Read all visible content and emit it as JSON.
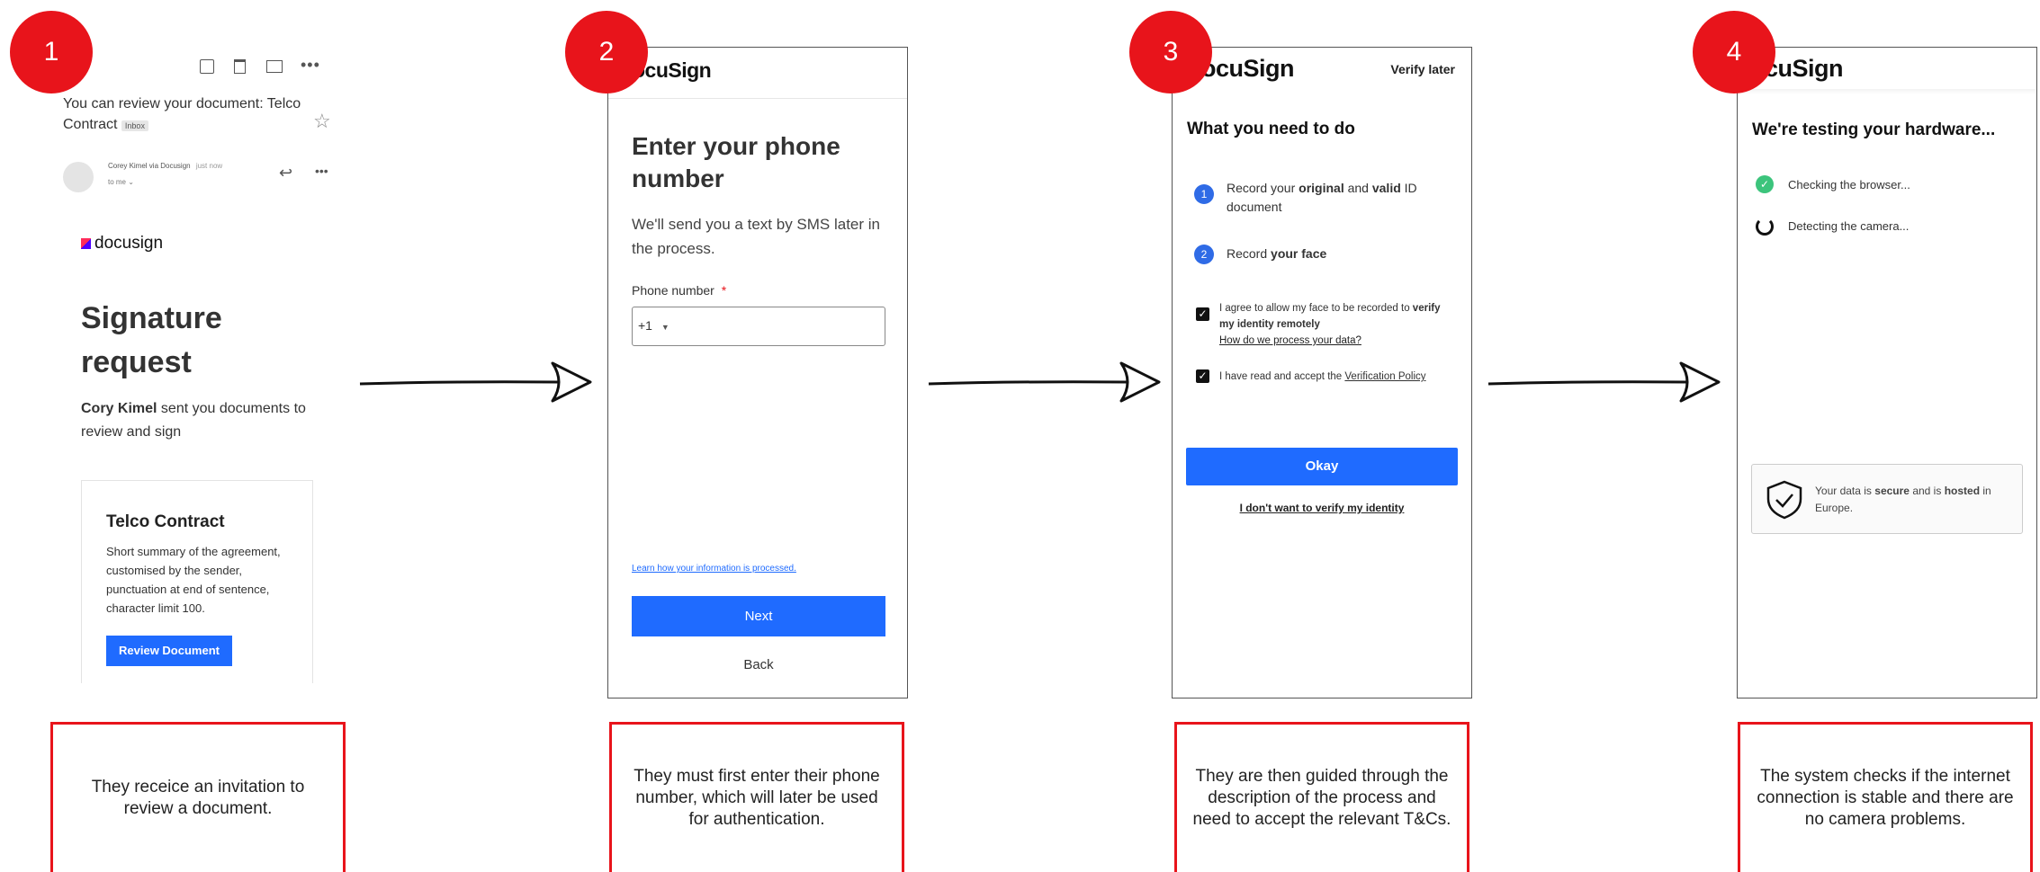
{
  "steps": [
    {
      "number": "1",
      "caption": "They receice an invitation to review a document.",
      "email": {
        "subject": "You can review your document: Telco Contract",
        "inbox_tag": "Inbox",
        "sender": "Corey Kimel via Docusign",
        "sent_time": "just now",
        "to_me": "to me",
        "brand": "docusign",
        "heading": "Signature request",
        "sender_name": "Cory Kimel",
        "message": "sent you documents to review and sign",
        "card_title": "Telco Contract",
        "card_summary": "Short summary of the agreement, customised by the sender, punctuation at end of sentence, character limit 100.",
        "review_button": "Review Document"
      }
    },
    {
      "number": "2",
      "caption": "They must first enter their phone number, which will later be used for authentication.",
      "screen": {
        "logo": "ocuSign",
        "title": "Enter your phone number",
        "subtitle": "We'll send you a text by SMS later in the process.",
        "field_label": "Phone number",
        "required_mark": "*",
        "country_code": "+1",
        "learn_link": "Learn how your information is processed.",
        "next_button": "Next",
        "back_button": "Back"
      }
    },
    {
      "number": "3",
      "caption": "They are then guided through the description of the process and need to accept the relevant T&Cs.",
      "screen": {
        "logo": "ocuSign",
        "verify_later": "Verify later",
        "title": "What you need to do",
        "step1_num": "1",
        "step1_a": "Record your ",
        "step1_b": "original",
        "step1_c": " and ",
        "step1_d": "valid",
        "step1_e": " ID document",
        "step2_num": "2",
        "step2_a": "Record ",
        "step2_b": "your face",
        "consent1_a": "I agree to allow my face to be recorded to ",
        "consent1_b": "verify my identity remotely",
        "consent1_link": "How do we process your data?",
        "consent2_a": "I have read and accept the ",
        "consent2_link": "Verification Policy",
        "okay_button": "Okay",
        "decline_link": "I don't want to verify my identity"
      }
    },
    {
      "number": "4",
      "caption": "The system checks if the internet connection is stable and there are no camera problems.",
      "screen": {
        "logo": "ocuSign",
        "title": "We're testing your hardware...",
        "check1": "Checking the browser...",
        "check2": "Detecting the camera...",
        "notice_a": "Your data is ",
        "notice_b": "secure",
        "notice_c": " and is ",
        "notice_d": "hosted",
        "notice_e": " in Europe."
      }
    }
  ],
  "colors": {
    "badge": "#e8141b",
    "caption_border": "#e8141b",
    "primary_blue": "#1f6bff",
    "docusign_blue": "#2f6be6"
  }
}
